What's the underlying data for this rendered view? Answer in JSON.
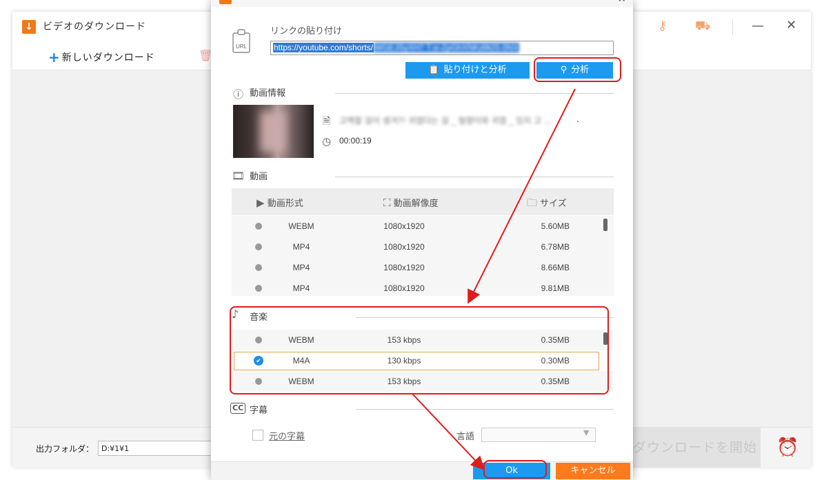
{
  "app": {
    "title": "ビデオのダウンロード",
    "new_download": "新しいダウンロード",
    "output_folder_label": "出力フォルダ：",
    "output_folder_value": "D:¥1¥1",
    "start_download": "ダウンロードを開始"
  },
  "dialog": {
    "paste_link_label": "リンクの貼り付け",
    "url_value": "https://youtube.com/shorts/",
    "url_blurred_tail": "WGEJSyXH7 T.si-ZpGhXNKd9t25.0NX",
    "url_icon_text": "URL",
    "paste_analyze_button": "貼り付けと分析",
    "analyze_button": "分析",
    "video_info_title": "動画情報",
    "video_name": "고백할 걸이 생겨?! 귀엽다는 걸 _ 형향이와 귀엽 _ 있지 고 ...",
    "video_duration": "00:00:19",
    "video_section_title": "動画",
    "columns": {
      "format": "動画形式",
      "resolution": "動画解像度",
      "size": "サイズ"
    },
    "video_rows": [
      {
        "format": "WEBM",
        "resolution": "1080x1920",
        "size": "5.60MB"
      },
      {
        "format": "MP4",
        "resolution": "1080x1920",
        "size": "6.78MB"
      },
      {
        "format": "MP4",
        "resolution": "1080x1920",
        "size": "8.66MB"
      },
      {
        "format": "MP4",
        "resolution": "1080x1920",
        "size": "9.81MB"
      }
    ],
    "music_section_title": "音楽",
    "music_rows": [
      {
        "format": "WEBM",
        "bitrate": "153 kbps",
        "size": "0.35MB"
      },
      {
        "format": "M4A",
        "bitrate": "130 kbps",
        "size": "0.30MB"
      },
      {
        "format": "WEBM",
        "bitrate": "153 kbps",
        "size": "0.35MB"
      }
    ],
    "subtitle_section_title": "字幕",
    "original_subtitle": "元の字幕",
    "language_label": "言語",
    "language_value": "",
    "ok_button": "Ok",
    "cancel_button": "キャンセル"
  },
  "icons": {
    "app_logo": "download-arrow-icon",
    "key": "key-icon",
    "cart": "cart-icon",
    "alarm": "alarm-clock-icon",
    "info": "info-icon",
    "file": "file-icon",
    "clock": "clock-icon",
    "film": "film-icon",
    "music": "music-note-icon",
    "cc": "cc-icon",
    "search": "search-icon",
    "clipboard": "clipboard-icon"
  },
  "colors": {
    "accent_blue": "#1b9af0",
    "accent_orange": "#ff7a1a",
    "annotation_red": "#e01b1b",
    "selected_row_border": "#e0a24e"
  }
}
